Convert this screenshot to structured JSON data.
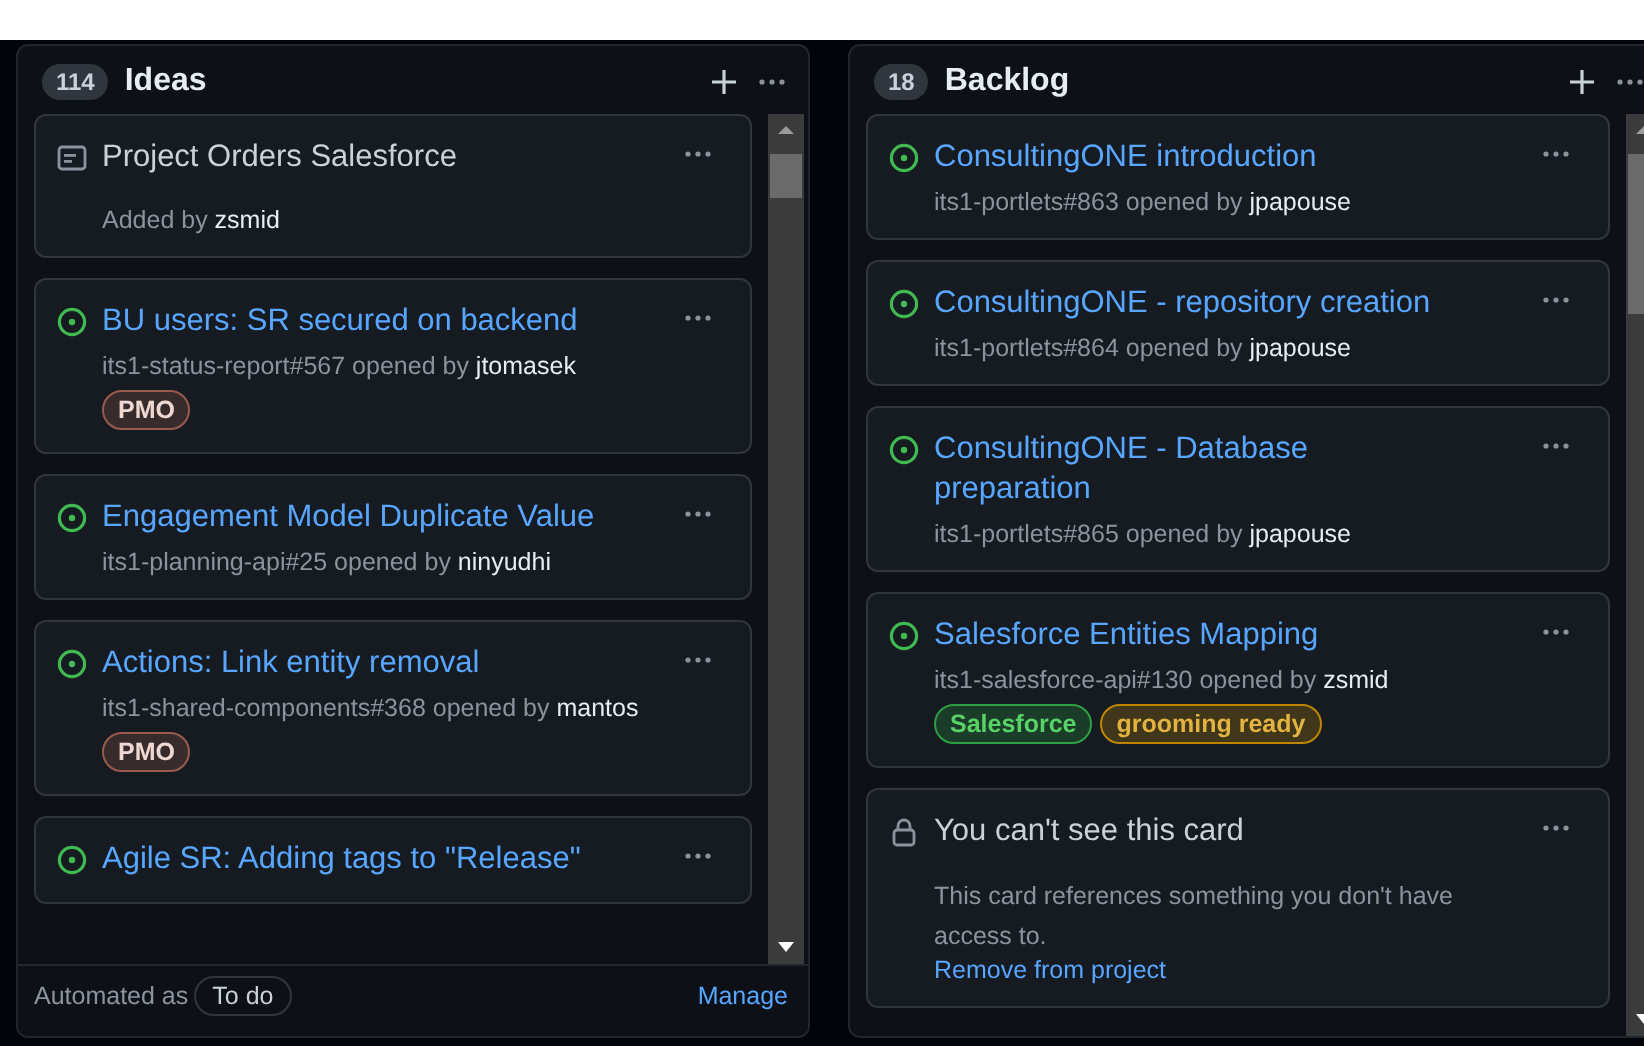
{
  "columns": [
    {
      "count": "114",
      "title": "Ideas",
      "cards": [
        {
          "kind": "note",
          "title": "Project Orders Salesforce",
          "meta": "Added by **zsmid**"
        },
        {
          "kind": "issue",
          "title": "BU users: SR secured on backend",
          "meta": "its1-status-report#567 opened by **jtomasek**",
          "labels": [
            {
              "name": "PMO",
              "color": "#9a5b4c"
            }
          ]
        },
        {
          "kind": "issue",
          "title": "Engagement Model Duplicate Value",
          "meta": "its1-planning-api#25 opened by **ninyudhi**"
        },
        {
          "kind": "issue",
          "title": "Actions: Link entity removal",
          "meta": "its1-shared-components#368 opened by **mantos**",
          "labels": [
            {
              "name": "PMO",
              "color": "#9a5b4c"
            }
          ]
        },
        {
          "kind": "issue",
          "title": "Agile SR: Adding tags to \"Release\""
        }
      ],
      "footer": {
        "text": "Automated as",
        "state": "To do",
        "link": "Manage"
      }
    },
    {
      "count": "18",
      "title": "Backlog",
      "cards": [
        {
          "kind": "issue",
          "title": "ConsultingONE introduction",
          "meta": "its1-portlets#863 opened by **jpapouse**"
        },
        {
          "kind": "issue",
          "title": "ConsultingONE - repository creation",
          "meta": "its1-portlets#864 opened by **jpapouse**"
        },
        {
          "kind": "issue",
          "title": "ConsultingONE - Database preparation",
          "meta": "its1-portlets#865 opened by **jpapouse**"
        },
        {
          "kind": "issue",
          "title": "Salesforce Entities Mapping",
          "meta": "its1-salesforce-api#130 opened by **zsmid**",
          "labels": [
            {
              "name": "Salesforce",
              "color": "#2ea043"
            },
            {
              "name": "grooming ready",
              "color": "#bf8700"
            }
          ]
        },
        {
          "kind": "restricted",
          "title": "You can't see this card",
          "body": "This card references something you don't have access to.",
          "link": "Remove from project"
        }
      ]
    }
  ]
}
